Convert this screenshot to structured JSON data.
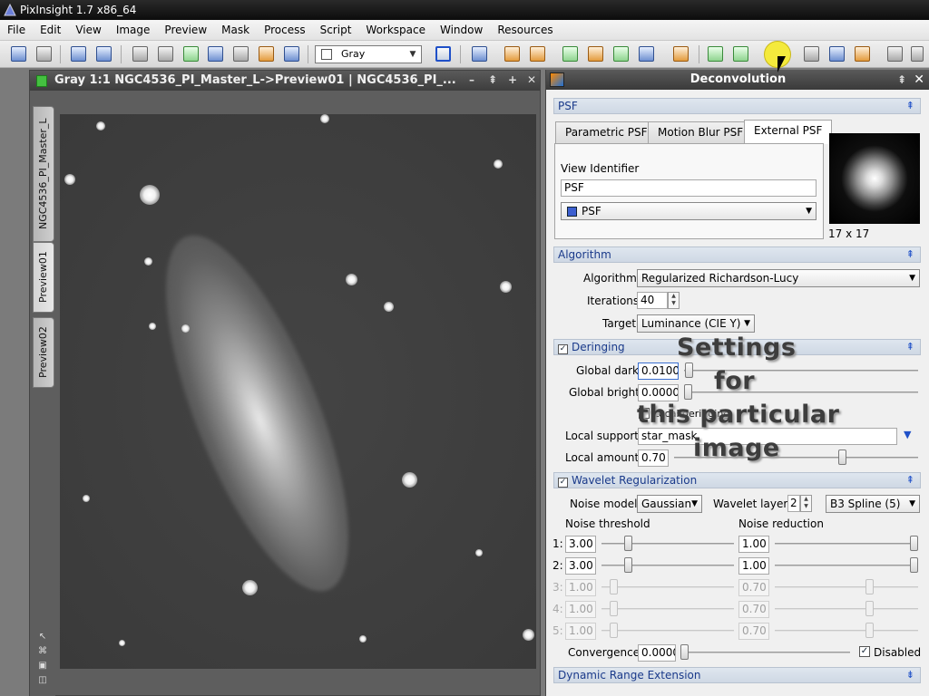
{
  "titlebar": {
    "title": "PixInsight 1.7 x86_64"
  },
  "menubar": {
    "items": [
      "File",
      "Edit",
      "View",
      "Image",
      "Preview",
      "Mask",
      "Process",
      "Script",
      "Workspace",
      "Window",
      "Resources"
    ]
  },
  "toolbar": {
    "display_channel": "Gray"
  },
  "image_window": {
    "title": "Gray 1:1 NGC4536_PI_Master_L->Preview01 | NGC4536_PI_...",
    "tabs": [
      "NGC4536_PI_Master_L",
      "Preview01",
      "Preview02"
    ]
  },
  "panel": {
    "title": "Deconvolution",
    "psf": {
      "section": "PSF",
      "tabs": [
        "Parametric PSF",
        "Motion Blur PSF",
        "External PSF"
      ],
      "view_identifier_label": "View Identifier",
      "view_identifier_value": "PSF",
      "view_select": "PSF",
      "psf_size": "17 x 17"
    },
    "algorithm": {
      "section": "Algorithm",
      "algorithm_label": "Algorithm:",
      "algorithm_value": "Regularized Richardson-Lucy",
      "iterations_label": "Iterations:",
      "iterations_value": "40",
      "target_label": "Target:",
      "target_value": "Luminance (CIE Y)"
    },
    "deringing": {
      "section": "Deringing",
      "checked": true,
      "global_dark_label": "Global dark:",
      "global_dark_value": "0.0100",
      "global_bright_label": "Global bright:",
      "global_bright_value": "0.0000",
      "local_deringing_label": "Local deringing",
      "local_support_label": "Local support:",
      "local_support_value": "star_mask",
      "local_amount_label": "Local amount:",
      "local_amount_value": "0.70"
    },
    "wavelet": {
      "section": "Wavelet Regularization",
      "checked": true,
      "noise_model_label": "Noise model:",
      "noise_model_value": "Gaussian",
      "wavelet_layers_label": "Wavelet layers:",
      "wavelet_layers_value": "2",
      "scaling_function": "B3 Spline (5)",
      "noise_threshold_label": "Noise threshold",
      "noise_reduction_label": "Noise reduction",
      "rows": [
        {
          "idx": "1:",
          "threshold": "3.00",
          "reduction": "1.00"
        },
        {
          "idx": "2:",
          "threshold": "3.00",
          "reduction": "1.00"
        },
        {
          "idx": "3:",
          "threshold": "1.00",
          "reduction": "0.70"
        },
        {
          "idx": "4:",
          "threshold": "1.00",
          "reduction": "0.70"
        },
        {
          "idx": "5:",
          "threshold": "1.00",
          "reduction": "0.70"
        }
      ],
      "convergence_label": "Convergence:",
      "convergence_value": "0.0000",
      "disabled_label": "Disabled"
    },
    "dre": {
      "section": "Dynamic Range Extension"
    }
  },
  "overlay": {
    "lines": [
      "Settings",
      "for",
      "this particular",
      "image"
    ]
  },
  "colors": {
    "accent": "#1f50c8",
    "highlight": "#f4ea3c",
    "section_text": "#1a3a8a"
  }
}
